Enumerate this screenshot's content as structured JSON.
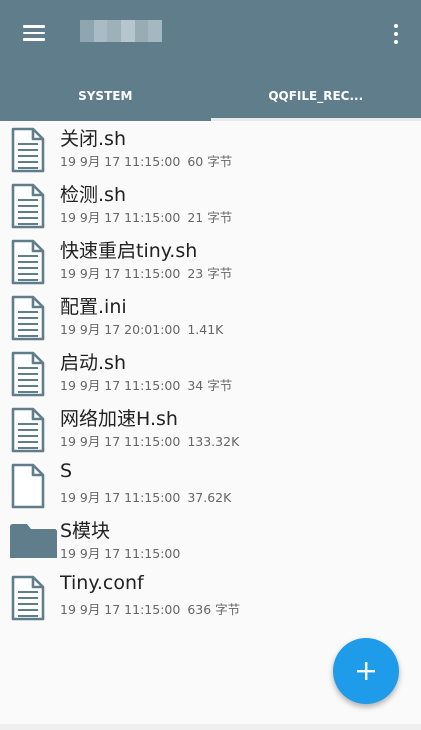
{
  "colors": {
    "appbar": "#607d8b",
    "fab": "#1e9be9",
    "icon": "#607d8b"
  },
  "toolbar": {
    "menu_icon": "hamburger-menu-icon",
    "more_icon": "more-vert-icon"
  },
  "tabs": [
    {
      "label": "SYSTEM",
      "selected": true
    },
    {
      "label": "QQFILE_REC...",
      "selected": false
    }
  ],
  "files": [
    {
      "name": "关闭.sh",
      "date": "19 9月 17 11:15:00",
      "size": "60 字节",
      "type": "text"
    },
    {
      "name": "检测.sh",
      "date": "19 9月 17 11:15:00",
      "size": "21 字节",
      "type": "text"
    },
    {
      "name": "快速重启tiny.sh",
      "date": "19 9月 17 11:15:00",
      "size": "23 字节",
      "type": "text"
    },
    {
      "name": "配置.ini",
      "date": "19 9月 17 20:01:00",
      "size": "1.41K",
      "type": "text"
    },
    {
      "name": "启动.sh",
      "date": "19 9月 17 11:15:00",
      "size": "34 字节",
      "type": "text"
    },
    {
      "name": "网络加速H.sh",
      "date": "19 9月 17 11:15:00",
      "size": "133.32K",
      "type": "text"
    },
    {
      "name": "S",
      "date": "19 9月 17 11:15:00",
      "size": "37.62K",
      "type": "blank"
    },
    {
      "name": "S模块",
      "date": "19 9月 17 11:15:00",
      "size": "",
      "type": "folder"
    },
    {
      "name": "Tiny.conf",
      "date": "19 9月 17 11:15:00",
      "size": "636 字节",
      "type": "text"
    }
  ],
  "fab": {
    "icon": "plus-icon"
  }
}
